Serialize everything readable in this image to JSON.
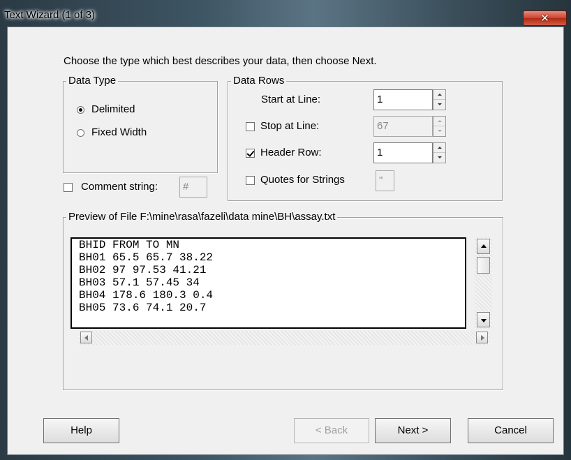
{
  "window": {
    "title": "Text Wizard (1 of 3)",
    "close_glyph": "✕"
  },
  "instructions": "Choose the type which best describes your data, then choose Next.",
  "data_type": {
    "legend": "Data Type",
    "options": [
      "Delimited",
      "Fixed Width"
    ],
    "selected": "Delimited"
  },
  "data_rows": {
    "legend": "Data Rows",
    "start_at_line": {
      "label": "Start at Line:",
      "value": "1"
    },
    "stop_at_line": {
      "label": "Stop at Line:",
      "checked": false,
      "value": "67"
    },
    "header_row": {
      "label": "Header Row:",
      "checked": true,
      "value": "1"
    },
    "quotes_for_strings": {
      "label": "Quotes for Strings",
      "checked": false,
      "value": "\""
    }
  },
  "comment": {
    "label": "Comment string:",
    "checked": false,
    "value": "#"
  },
  "preview": {
    "legend": "Preview of File F:\\mine\\rasa\\fazeli\\data mine\\BH\\assay.txt",
    "lines": [
      "BHID FROM TO MN",
      "BH01 65.5 65.7 38.22",
      "BH02 97 97.53 41.21",
      "BH03 57.1 57.45 34",
      "BH04 178.6 180.3 0.4",
      "BH05 73.6 74.1 20.7"
    ]
  },
  "buttons": {
    "help": "Help",
    "back": "< Back",
    "next": "Next >",
    "cancel": "Cancel"
  },
  "colors": {
    "dialog_bg": "#f0f0f0",
    "close_button": "#c8432e",
    "frame": "#3e5563"
  },
  "icons": [
    "close-icon",
    "spin-up-icon",
    "spin-down-icon",
    "scroll-up-icon",
    "scroll-down-icon",
    "scroll-left-icon",
    "scroll-right-icon"
  ]
}
